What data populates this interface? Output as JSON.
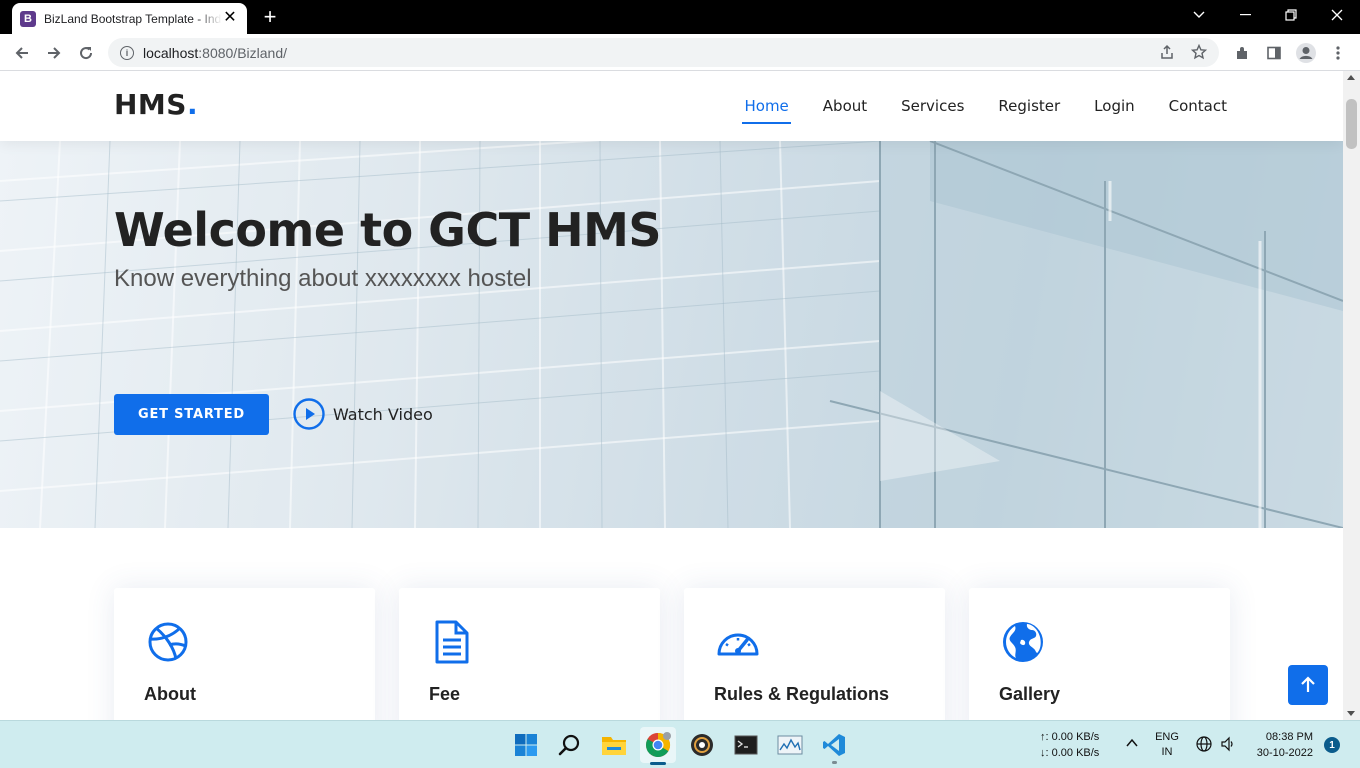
{
  "browser": {
    "tab_title": "BizLand Bootstrap Template - Index",
    "tab_favicon_letter": "B",
    "url_host": "localhost",
    "url_rest": ":8080/Bizland/"
  },
  "site": {
    "logo_text": "HMS",
    "logo_dot": ".",
    "nav": [
      {
        "label": "Home",
        "active": true
      },
      {
        "label": "About",
        "active": false
      },
      {
        "label": "Services",
        "active": false
      },
      {
        "label": "Register",
        "active": false
      },
      {
        "label": "Login",
        "active": false
      },
      {
        "label": "Contact",
        "active": false
      }
    ],
    "accent_color": "#106eea"
  },
  "hero": {
    "title": "Welcome to GCT HMS",
    "subtitle": "Know everything about xxxxxxxx hostel",
    "cta_label": "GET STARTED",
    "video_label": "Watch Video"
  },
  "cards": [
    {
      "title": "About",
      "icon": "dribbble-icon"
    },
    {
      "title": "Fee",
      "icon": "document-icon"
    },
    {
      "title": "Rules & Regulations",
      "icon": "speedometer-icon"
    },
    {
      "title": "Gallery",
      "icon": "globe-icon"
    }
  ],
  "taskbar": {
    "upload_speed": "↑: 0.00 KB/s",
    "download_speed": "↓: 0.00 KB/s",
    "lang_line1": "ENG",
    "lang_line2": "IN",
    "time": "08:38 PM",
    "date": "30-10-2022",
    "notification_count": "1"
  }
}
